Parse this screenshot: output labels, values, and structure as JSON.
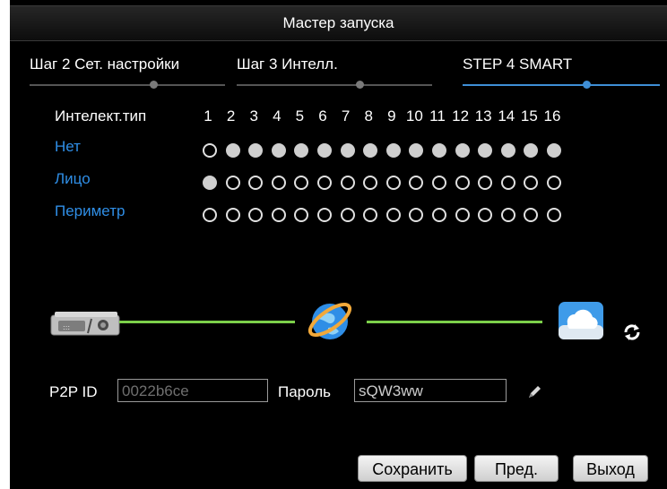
{
  "window": {
    "title": "Мастер запуска"
  },
  "steps": [
    {
      "label": "Шаг 2 Сет. настройки",
      "active": false
    },
    {
      "label": "Шаг 3 Интелл.",
      "active": false
    },
    {
      "label": "STEP 4 SMART",
      "active": true
    }
  ],
  "intel": {
    "header": "Интелект.тип",
    "channels": [
      "1",
      "2",
      "3",
      "4",
      "5",
      "6",
      "7",
      "8",
      "9",
      "10",
      "11",
      "12",
      "13",
      "14",
      "15",
      "16"
    ],
    "rows": [
      {
        "label": "Нет",
        "selected": [
          false,
          true,
          true,
          true,
          true,
          true,
          true,
          true,
          true,
          true,
          true,
          true,
          true,
          true,
          true,
          true
        ]
      },
      {
        "label": "Лицо",
        "selected": [
          true,
          false,
          false,
          false,
          false,
          false,
          false,
          false,
          false,
          false,
          false,
          false,
          false,
          false,
          false,
          false
        ]
      },
      {
        "label": "Периметр",
        "selected": [
          false,
          false,
          false,
          false,
          false,
          false,
          false,
          false,
          false,
          false,
          false,
          false,
          false,
          false,
          false,
          false
        ]
      }
    ]
  },
  "icons": {
    "device": "dvr-device-icon",
    "internet": "internet-globe-icon",
    "cloud": "cloud-storage-icon",
    "refresh": "refresh-icon",
    "edit": "pencil-icon"
  },
  "colors": {
    "accent": "#3f8fd6",
    "link": "#2f8ee6",
    "connection": "#7cd04a"
  },
  "p2p": {
    "id_label": "P2P ID",
    "id_value": "0022b6ce",
    "password_label": "Пароль",
    "password_value": "sQW3ww"
  },
  "buttons": {
    "save": "Сохранить",
    "prev": "Пред.",
    "exit": "Выход"
  }
}
